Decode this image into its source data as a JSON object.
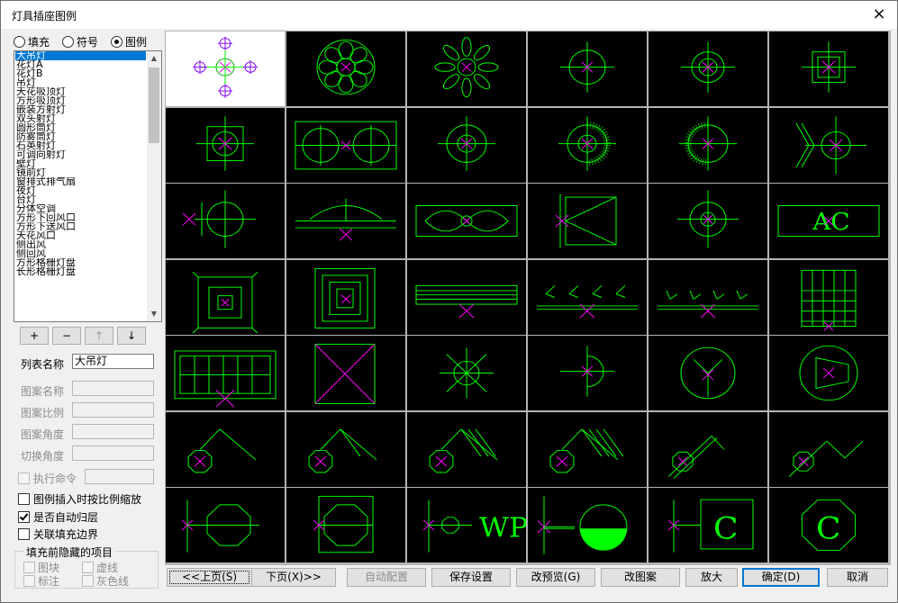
{
  "window": {
    "title": "灯具插座图例",
    "close_glyph": "×"
  },
  "mode_radios": [
    {
      "label": "填充",
      "checked": false
    },
    {
      "label": "符号",
      "checked": false
    },
    {
      "label": "图例",
      "checked": true
    }
  ],
  "list": {
    "selected_index": 0,
    "items": [
      "大吊灯",
      "花灯A",
      "花灯B",
      "吊灯",
      "天花吸顶灯",
      "方形吸顶灯",
      "嵌装方射灯",
      "双头射灯",
      "圆形筒灯",
      "防雾筒灯",
      "石英射灯",
      "可调向射灯",
      "壁灯",
      "镜前灯",
      "窗排式排气扇",
      "夜灯",
      "台灯",
      "分体空调",
      "方形下回风口",
      "方形下送风口",
      "天花风口",
      "侧出风",
      "侧回风",
      "方形格栅灯盘",
      "长形格栅灯盘"
    ]
  },
  "list_buttons": [
    {
      "label": "+",
      "enabled": true
    },
    {
      "label": "−",
      "enabled": true
    },
    {
      "label": "↑",
      "enabled": false
    },
    {
      "label": "↓",
      "enabled": true
    }
  ],
  "fields": {
    "list_name": {
      "label": "列表名称",
      "value": "大吊灯"
    },
    "pattern_name": {
      "label": "图案名称",
      "value": ""
    },
    "pattern_scale": {
      "label": "图案比例",
      "value": ""
    },
    "pattern_angle": {
      "label": "图案角度",
      "value": ""
    },
    "switch_angle": {
      "label": "切换角度",
      "value": ""
    },
    "exec_command": {
      "label": "执行命令",
      "value": ""
    }
  },
  "checks": [
    {
      "label": "图例插入时按比例缩放",
      "checked": false
    },
    {
      "label": "是否自动归层",
      "checked": true
    },
    {
      "label": "关联填充边界",
      "checked": false
    }
  ],
  "hide_group": {
    "title": "填充前隐藏的项目",
    "items": [
      {
        "label": "图块",
        "checked": false
      },
      {
        "label": "虚线",
        "checked": false
      },
      {
        "label": "标注",
        "checked": false
      },
      {
        "label": "灰色线",
        "checked": false
      }
    ]
  },
  "grid_text": {
    "ac": "AC",
    "wp": "WP",
    "c1": "C",
    "c2": "C"
  },
  "bottom_buttons": [
    {
      "label": "<<上页(S)",
      "enabled": true
    },
    {
      "label": "下页(X)>>",
      "enabled": true
    },
    {
      "label": "自动配置",
      "enabled": false
    },
    {
      "label": "保存设置",
      "enabled": true
    },
    {
      "label": "改预览(G)",
      "enabled": true
    },
    {
      "label": "改图案",
      "enabled": true
    },
    {
      "label": "放大",
      "enabled": true
    },
    {
      "label": "确定(D)",
      "enabled": true
    },
    {
      "label": "取消",
      "enabled": true
    }
  ],
  "colors": {
    "line": "#00ff00",
    "accent": "#ff00ff",
    "grid_bg": "#000000",
    "selection": "#0078d7"
  }
}
